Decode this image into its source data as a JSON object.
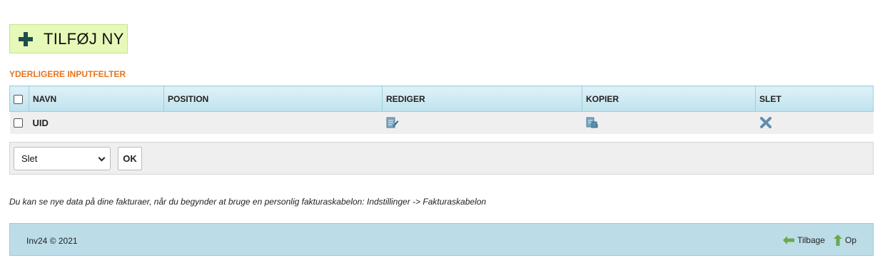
{
  "toolbar": {
    "add_label": "TILFØJ NY"
  },
  "section": {
    "title": "YDERLIGERE INPUTFELTER"
  },
  "table": {
    "headers": {
      "name": "NAVN",
      "position": "POSITION",
      "edit": "REDIGER",
      "copy": "KOPIER",
      "delete": "SLET"
    },
    "rows": [
      {
        "name": "UID",
        "position": ""
      }
    ]
  },
  "actions": {
    "selected": "Slet",
    "ok_label": "OK"
  },
  "info_text": "Du kan se nye data på dine fakturaer, når du begynder at bruge en personlig fakturaskabelon: Indstillinger -> Fakturaskabelon",
  "footer": {
    "copyright": "Inv24 © 2021",
    "back_label": "Tilbage",
    "up_label": "Op"
  },
  "icons": {
    "add": "plus-icon",
    "edit": "edit-icon",
    "copy": "copy-icon",
    "delete": "delete-x-icon",
    "back": "arrow-left-icon",
    "up": "arrow-up-icon"
  },
  "colors": {
    "add_button_bg": "#e6f9b8",
    "section_title": "#e8741e",
    "header_bg": "#bfe3ee",
    "footer_bg": "#bcdde8",
    "icon_blue": "#5a8fb0",
    "arrow_green": "#6aa84f"
  }
}
